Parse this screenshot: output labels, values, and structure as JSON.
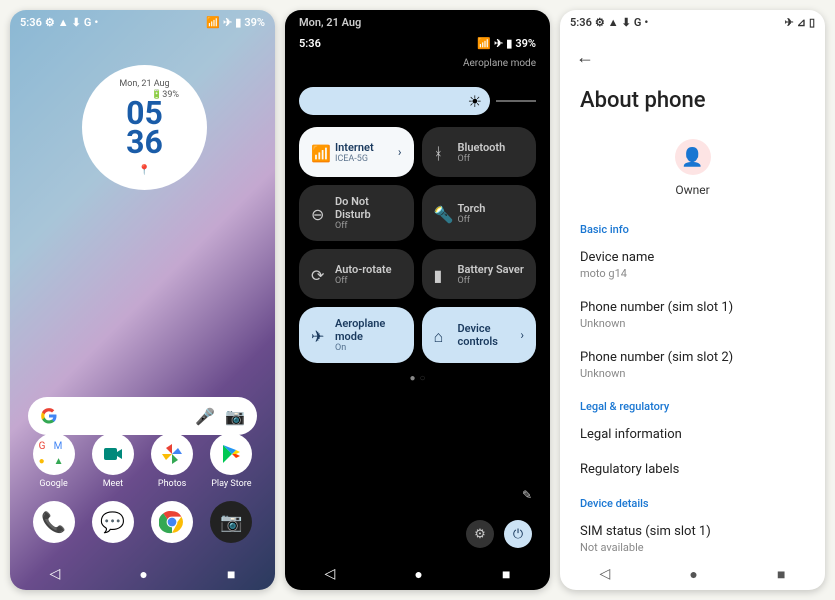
{
  "statusbar": {
    "time": "5:36",
    "battery": "39%"
  },
  "p1": {
    "widget": {
      "date": "Mon, 21 Aug",
      "battery": "39%",
      "h": "05",
      "m": "36"
    },
    "apps_row1": [
      {
        "label": "Google"
      },
      {
        "label": "Meet"
      },
      {
        "label": "Photos"
      },
      {
        "label": "Play Store"
      }
    ],
    "dock": [
      {
        "name": "phone"
      },
      {
        "name": "messages"
      },
      {
        "name": "chrome"
      },
      {
        "name": "camera"
      }
    ]
  },
  "p2": {
    "date": "Mon, 21 Aug",
    "sub_time": "5:36",
    "sub_mode": "Aeroplane mode",
    "tiles": [
      {
        "title": "Internet",
        "sub": "ICEA-5G",
        "on": true,
        "style": "onw",
        "chev": true,
        "icon": "wifi"
      },
      {
        "title": "Bluetooth",
        "sub": "Off",
        "on": false,
        "icon": "bluetooth"
      },
      {
        "title": "Do Not Disturb",
        "sub": "Off",
        "on": false,
        "icon": "dnd"
      },
      {
        "title": "Torch",
        "sub": "Off",
        "on": false,
        "icon": "torch"
      },
      {
        "title": "Auto-rotate",
        "sub": "Off",
        "on": false,
        "icon": "rotate"
      },
      {
        "title": "Battery Saver",
        "sub": "Off",
        "on": false,
        "icon": "battery"
      },
      {
        "title": "Aeroplane mode",
        "sub": "On",
        "on": true,
        "style": "on",
        "icon": "plane"
      },
      {
        "title": "Device controls",
        "sub": "",
        "on": true,
        "style": "on",
        "chev": true,
        "icon": "home"
      }
    ]
  },
  "p3": {
    "title": "About phone",
    "owner": "Owner",
    "sections": [
      {
        "header": "Basic info",
        "items": [
          {
            "t": "Device name",
            "s": "moto g14"
          },
          {
            "t": "Phone number (sim slot 1)",
            "s": "Unknown"
          },
          {
            "t": "Phone number (sim slot 2)",
            "s": "Unknown"
          }
        ]
      },
      {
        "header": "Legal & regulatory",
        "items": [
          {
            "t": "Legal information"
          },
          {
            "t": "Regulatory labels"
          }
        ]
      },
      {
        "header": "Device details",
        "items": [
          {
            "t": "SIM status (sim slot 1)",
            "s": "Not available"
          }
        ]
      }
    ]
  }
}
